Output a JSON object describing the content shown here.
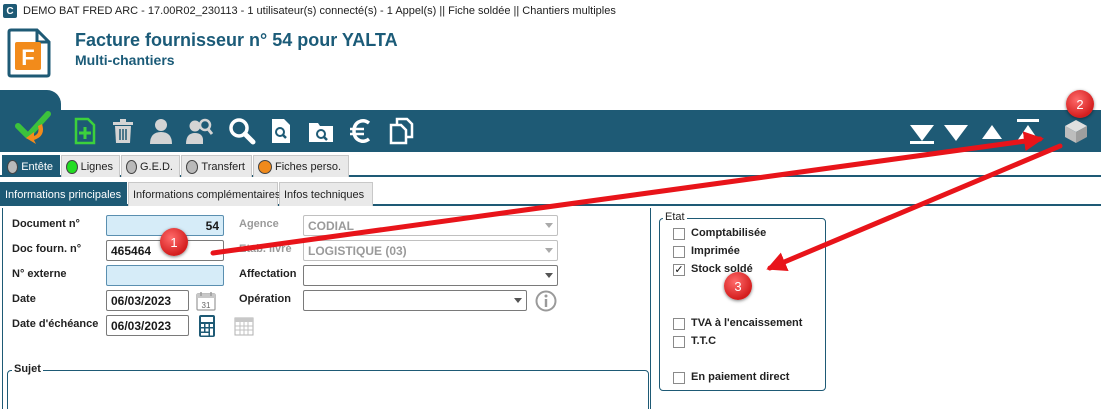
{
  "window": {
    "title": "DEMO BAT FRED ARC - 17.00R02_230113 - 1 utilisateur(s) connecté(s) - 1 Appel(s) || Fiche soldée || Chantiers multiples",
    "app_icon_letter": "C"
  },
  "header": {
    "doc_icon_letter": "F",
    "title": "Facture fournisseur n° 54 pour YALTA",
    "subtitle": "Multi-chantiers"
  },
  "toolbar": {
    "left_icons": [
      "validate-icon",
      "add-document-icon",
      "trash-icon",
      "user-icon",
      "user-search-icon",
      "search-icon",
      "document-search-icon",
      "folder-search-icon",
      "euro-icon",
      "copy-documents-icon"
    ],
    "right_icons": [
      "last-icon",
      "next-icon",
      "previous-icon",
      "first-icon",
      "cube-icon"
    ]
  },
  "section_tabs": [
    {
      "label": "Entête",
      "dot_color": "#b9b9b9",
      "active": true
    },
    {
      "label": "Lignes",
      "dot_color": "#22dd22",
      "active": false
    },
    {
      "label": "G.E.D.",
      "dot_color": "#b9b9b9",
      "active": false
    },
    {
      "label": "Transfert",
      "dot_color": "#b9b9b9",
      "active": false
    },
    {
      "label": "Fiches perso.",
      "dot_color": "#f08a1c",
      "active": false
    }
  ],
  "sub_tabs": [
    {
      "label": "Informations principales",
      "active": true
    },
    {
      "label": "Informations complémentaires",
      "active": false
    },
    {
      "label": "Infos techniques",
      "active": false
    }
  ],
  "form": {
    "document_no_label": "Document n°",
    "document_no_value": "54",
    "doc_fourn_label": "Doc fourn. n°",
    "doc_fourn_value": "465464",
    "no_externe_label": "N° externe",
    "no_externe_value": "",
    "date_label": "Date",
    "date_value": "06/03/2023",
    "date_echeance_label": "Date d'échéance",
    "date_echeance_value": "06/03/2023",
    "agence_label": "Agence",
    "agence_value": "CODIAL",
    "etab_livre_label": "Etab. livré",
    "etab_livre_value": "LOGISTIQUE (03)",
    "affectation_label": "Affectation",
    "affectation_value": "",
    "operation_label": "Opération",
    "operation_value": "",
    "calendar_day": "31"
  },
  "etat": {
    "legend": "Etat",
    "items": [
      {
        "label": "Comptabilisée",
        "checked": false
      },
      {
        "label": "Imprimée",
        "checked": false
      },
      {
        "label": "Stock soldé",
        "checked": true
      },
      {
        "label": "TVA à l'encaissement",
        "checked": false
      },
      {
        "label": "T.T.C",
        "checked": false
      },
      {
        "label": "En paiement direct",
        "checked": false
      }
    ]
  },
  "sujet": {
    "legend": "Sujet",
    "value": ""
  },
  "annotations": {
    "badge_1": "1",
    "badge_2": "2",
    "badge_3": "3",
    "arrow_color": "#e8141a"
  }
}
